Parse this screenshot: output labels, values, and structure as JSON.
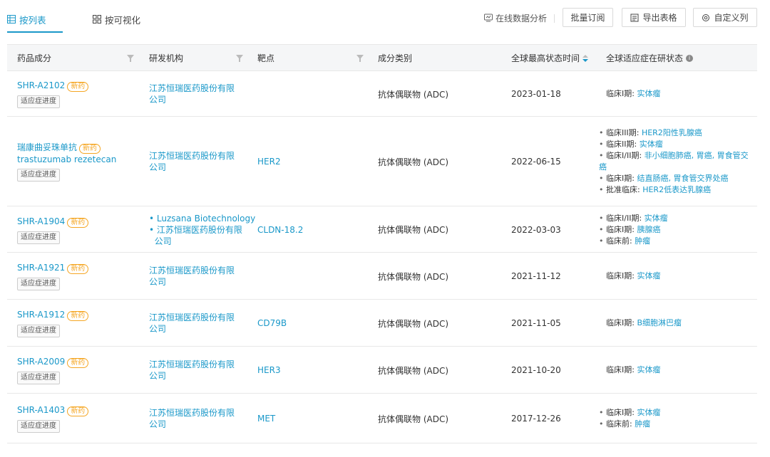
{
  "tabs": [
    {
      "label": "按列表",
      "active": true
    },
    {
      "label": "按可视化",
      "active": false
    }
  ],
  "toolbar": {
    "online_analysis": "在线数据分析",
    "batch_subscribe": "批量订阅",
    "export_table": "导出表格",
    "custom_columns": "自定义列"
  },
  "columns": [
    "药品成分",
    "研发机构",
    "靶点",
    "成分类别",
    "全球最高状态时间",
    "全球适应症在研状态"
  ],
  "labels": {
    "new_drug": "新药",
    "progress": "适应症进度"
  },
  "colors": {
    "accent": "#1a98c9",
    "new_tag": "#f5a623"
  },
  "rows": [
    {
      "drug": [
        "SHR-A2102"
      ],
      "orgs": [
        "江苏恒瑞医药股份有限",
        "公司"
      ],
      "org_list": [],
      "target": "",
      "category": "抗体偶联物 (ADC)",
      "date": "2023-01-18",
      "status": [
        {
          "phase": "临床I期:",
          "items": "实体瘤"
        }
      ],
      "status_bulleted": false
    },
    {
      "drug": [
        "瑞康曲妥珠单抗",
        "trastuzumab rezetecan"
      ],
      "orgs": [
        "江苏恒瑞医药股份有限",
        "公司"
      ],
      "org_list": [],
      "target": "HER2",
      "category": "抗体偶联物 (ADC)",
      "date": "2022-06-15",
      "status": [
        {
          "phase": "临床III期:",
          "items": "HER2阳性乳腺癌"
        },
        {
          "phase": "临床II期:",
          "items": "实体瘤"
        },
        {
          "phase": "临床I/II期:",
          "items": "非小细胞肺癌, 胃癌, 胃食管交",
          "cont": "癌"
        },
        {
          "phase": "临床I期:",
          "items": "结直肠癌, 胃食管交界处癌"
        },
        {
          "phase": "批准临床:",
          "items": "HER2低表达乳腺癌"
        }
      ],
      "status_bulleted": true
    },
    {
      "drug": [
        "SHR-A1904"
      ],
      "orgs": [],
      "org_list": [
        [
          "Luzsana Biotechnology"
        ],
        [
          "江苏恒瑞医药股份有限",
          "公司"
        ]
      ],
      "target": "CLDN-18.2",
      "category": "抗体偶联物 (ADC)",
      "date": "2022-03-03",
      "status": [
        {
          "phase": "临床I/II期:",
          "items": "实体瘤"
        },
        {
          "phase": "临床I期:",
          "items": "胰腺癌"
        },
        {
          "phase": "临床前:",
          "items": "肿瘤"
        }
      ],
      "status_bulleted": true
    },
    {
      "drug": [
        "SHR-A1921"
      ],
      "orgs": [
        "江苏恒瑞医药股份有限",
        "公司"
      ],
      "org_list": [],
      "target": "",
      "category": "抗体偶联物 (ADC)",
      "date": "2021-11-12",
      "status": [
        {
          "phase": "临床I期:",
          "items": "实体瘤"
        }
      ],
      "status_bulleted": false
    },
    {
      "drug": [
        "SHR-A1912"
      ],
      "orgs": [
        "江苏恒瑞医药股份有限",
        "公司"
      ],
      "org_list": [],
      "target": "CD79B",
      "category": "抗体偶联物 (ADC)",
      "date": "2021-11-05",
      "status": [
        {
          "phase": "临床I期:",
          "items": "B细胞淋巴瘤"
        }
      ],
      "status_bulleted": false
    },
    {
      "drug": [
        "SHR-A2009"
      ],
      "orgs": [
        "江苏恒瑞医药股份有限",
        "公司"
      ],
      "org_list": [],
      "target": "HER3",
      "category": "抗体偶联物 (ADC)",
      "date": "2021-10-20",
      "status": [
        {
          "phase": "临床I期:",
          "items": "实体瘤"
        }
      ],
      "status_bulleted": false
    },
    {
      "drug": [
        "SHR-A1403"
      ],
      "orgs": [
        "江苏恒瑞医药股份有限",
        "公司"
      ],
      "org_list": [],
      "target": "MET",
      "category": "抗体偶联物 (ADC)",
      "date": "2017-12-26",
      "status": [
        {
          "phase": "临床I期:",
          "items": "实体瘤"
        },
        {
          "phase": "临床前:",
          "items": "肿瘤"
        }
      ],
      "status_bulleted": true
    }
  ]
}
